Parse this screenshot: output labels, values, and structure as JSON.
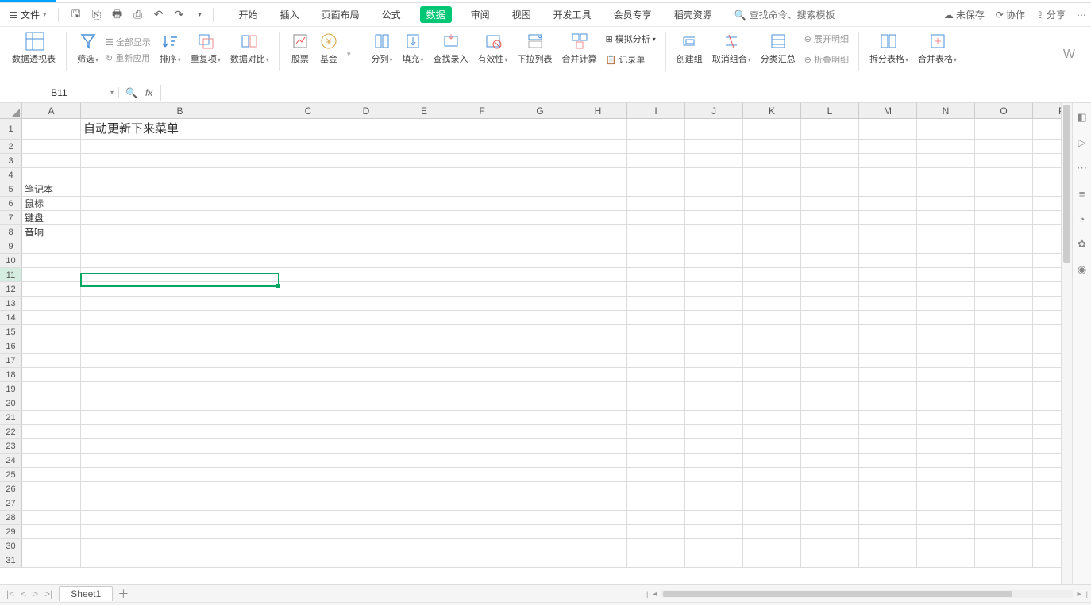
{
  "file_menu": "文件",
  "menu_tabs": [
    "开始",
    "插入",
    "页面布局",
    "公式",
    "数据",
    "审阅",
    "视图",
    "开发工具",
    "会员专享",
    "稻壳资源"
  ],
  "active_tab_index": 4,
  "search_placeholder": "查找命令、搜索模板",
  "right_actions": {
    "unsaved": "未保存",
    "collab": "协作",
    "share": "分享"
  },
  "ribbon": {
    "pivot": "数据透视表",
    "filter": "筛选",
    "show_all": "全部显示",
    "reapply": "重新应用",
    "sort": "排序",
    "dup": "重复项",
    "compare": "数据对比",
    "stock": "股票",
    "fund": "基金",
    "split": "分列",
    "fill": "填充",
    "find_input": "查找录入",
    "validity": "有效性",
    "dropdown_list": "下拉列表",
    "consolidate": "合并计算",
    "whatif": "模拟分析",
    "record": "记录单",
    "group": "创建组",
    "ungroup": "取消组合",
    "subtotal": "分类汇总",
    "expand": "展开明细",
    "collapse": "折叠明细",
    "split_table": "拆分表格",
    "merge_table": "合并表格",
    "W": "W"
  },
  "namebox": "B11",
  "fx": "fx",
  "columns": [
    "A",
    "B",
    "C",
    "D",
    "E",
    "F",
    "G",
    "H",
    "I",
    "J",
    "K",
    "L",
    "M",
    "N",
    "O",
    "P"
  ],
  "row_count": 31,
  "cells": {
    "B1": "自动更新下来菜单",
    "A5": "笔记本",
    "A6": "鼠标",
    "A7": "键盘",
    "A8": "音响"
  },
  "selected_cell": "B11",
  "sheet_tab": "Sheet1"
}
